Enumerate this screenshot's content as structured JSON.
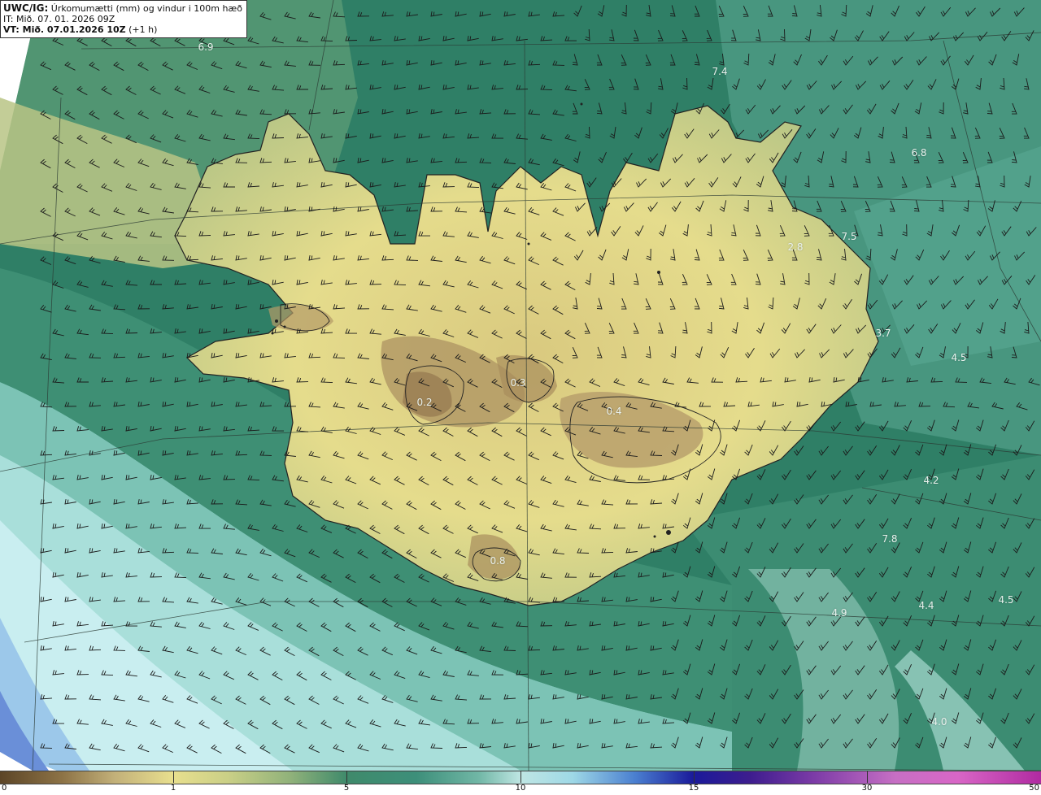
{
  "header": {
    "model": "UWC/IG:",
    "title": "Úrkomumætti (mm) og vindur i 100m hæð",
    "it_line": "IT: Mið. 07. 01. 2026 09Z",
    "vt_label": "VT: Mið. 07.01.2026 10Z",
    "vt_offset": "(+1 h)"
  },
  "value_labels": [
    {
      "text": "6.9",
      "id": "label-6-9-nw"
    },
    {
      "text": "7.4",
      "id": "label-7-4-n"
    },
    {
      "text": "6.8",
      "id": "label-6-8-ne"
    },
    {
      "text": "2.8",
      "id": "label-2-8-east"
    },
    {
      "text": "7.5",
      "id": "label-7-5-east"
    },
    {
      "text": "3.7",
      "id": "label-3-7-east"
    },
    {
      "text": "4.5",
      "id": "label-4-5-east"
    },
    {
      "text": "0.3",
      "id": "label-0-3-center"
    },
    {
      "text": "0.2",
      "id": "label-0-2-center"
    },
    {
      "text": "0.4",
      "id": "label-0-4-center"
    },
    {
      "text": "4.2",
      "id": "label-4-2-se"
    },
    {
      "text": "7.8",
      "id": "label-7-8-se"
    },
    {
      "text": "0.8",
      "id": "label-0-8-south"
    },
    {
      "text": "4.9",
      "id": "label-4-9-se"
    },
    {
      "text": "4.4",
      "id": "label-4-4-se"
    },
    {
      "text": "4.5",
      "id": "label-4-5-se"
    },
    {
      "text": "4.0",
      "id": "label-4-0-se"
    }
  ],
  "colorbar": {
    "ticks": [
      "0",
      "1",
      "5",
      "10",
      "15",
      "30",
      "50"
    ],
    "colors": {
      "low": "#5c4527",
      "dry": "#e8df8e",
      "moderate": "#3f8a6b",
      "wet": "#bfe6e3",
      "heavy": "#1a1a9a",
      "extreme": "#b02aa1"
    }
  }
}
